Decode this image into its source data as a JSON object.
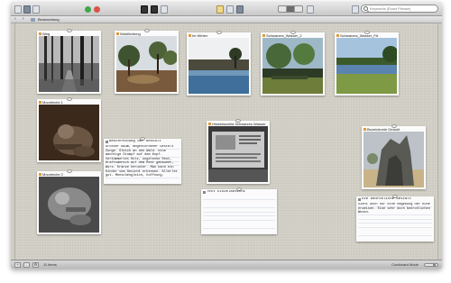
{
  "toolbar": {
    "search_placeholder": "Keywords (Exact Phrase)"
  },
  "pathbar": {
    "location": "Beobachtung"
  },
  "cards": {
    "weg": {
      "label": "Weg"
    },
    "waldlichtung": {
      "label": "Waldlichtung"
    },
    "im_winter": {
      "label": "Im Winter"
    },
    "schwarzes_wasser_2": {
      "label": "Schwarzes_Wasser_2"
    },
    "schwarzes_wasser_fa": {
      "label": "Schwarzes_Wasser_FA"
    },
    "moorleiche_1": {
      "label": "Moorleiche 1"
    },
    "moorleiche_2": {
      "label": "Moorleiche 2"
    },
    "hinweisschild": {
      "label": "Hinweisschild Schwarzes Wasser"
    },
    "bezeichnete_gestalt": {
      "label": "Bezeichnete Gestalt"
    }
  },
  "notes": {
    "beschreibung": {
      "title": "Beschreibung der Gestalt",
      "text": "Grosser Baum, abgestorbener Gestalt Zunge. Gleich an den Wald. eine mächtige Stumpf auf dem Kopf. Verkümmertes Holz, ungelenke Rest, Kraftsmensch auf dem Rest gebaueet, Wurz. Kranze herunter. Man kann ein Kinder vom Gesicht erkennen. Allerlei gut. Menschengleich, hoffnung."
    },
    "text_einzelansicht": {
      "title": "Text Einzelansicht",
      "text": ""
    },
    "bedrohliche_gestalt": {
      "title": "Die bedrohliche Gestalt",
      "text": "Sieht doch nur eine Umgebung der Ruhe erweisen. Eine sehr doch bedrohlichen Wesen."
    }
  },
  "statusbar": {
    "item_count": "11 items",
    "mode": "Corkboard Mode",
    "add_label": "+",
    "remove_label": "-"
  },
  "colors": {
    "board": "#d4d2c8",
    "photo_tag": "#e09a3a",
    "note_rule": "#c8d3e3"
  }
}
